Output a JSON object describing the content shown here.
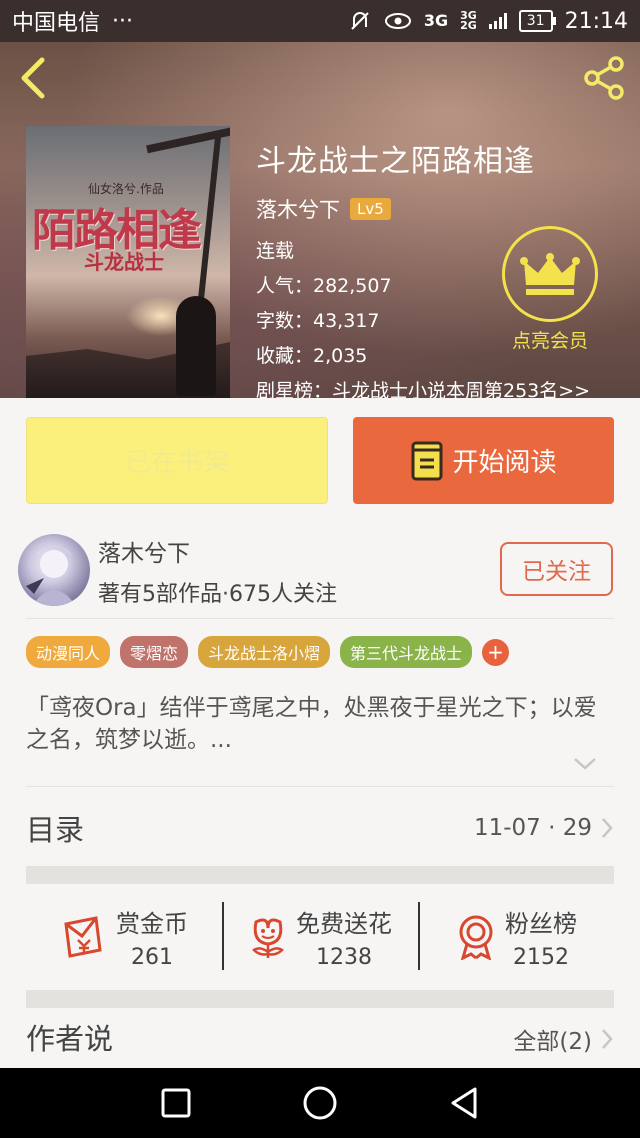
{
  "status_bar": {
    "carrier": "中国电信",
    "dots": "···",
    "network_3g": "3G",
    "network_3g_small": "3G",
    "network_2g_small": "2G",
    "battery": "31",
    "time": "21:14"
  },
  "book": {
    "title": "斗龙战士之陌路相逢",
    "author": "落木兮下",
    "level": "Lv5",
    "status": "连载",
    "popularity": "人气：282,507",
    "word_count": "字数：43,317",
    "favorites": "收藏：2,035",
    "rank": "剧星榜：斗龙战士小说本周第253名>>",
    "cover": {
      "author_line": "仙女洛兮.作品",
      "title": "陌路相逢",
      "subtitle": "斗龙战士"
    }
  },
  "vip": {
    "label": "点亮会员"
  },
  "buttons": {
    "shelf": "已在书架",
    "read": "开始阅读"
  },
  "author_info": {
    "name": "落木兮下",
    "meta": "著有5部作品·675人关注",
    "follow": "已关注"
  },
  "tags": [
    {
      "label": "动漫同人",
      "color": "#f0a93c"
    },
    {
      "label": "零熠恋",
      "color": "#c0736a"
    },
    {
      "label": "斗龙战士洛小熠",
      "color": "#d8a43c"
    },
    {
      "label": "第三代斗龙战士",
      "color": "#8ab34a"
    }
  ],
  "tag_add": "+",
  "intro": "「鸢夜Ora」结伴于鸢尾之中，处黑夜于星光之下；以爱之名，筑梦以逝。...",
  "catalog": {
    "title": "目录",
    "latest": "11-07 · 29"
  },
  "stats": [
    {
      "label": "赏金币",
      "value": "261",
      "icon": "red-envelope-yen-icon"
    },
    {
      "label": "免费送花",
      "value": "1238",
      "icon": "flower-icon"
    },
    {
      "label": "粉丝榜",
      "value": "2152",
      "icon": "award-ribbon-icon"
    }
  ],
  "author_says": {
    "title": "作者说",
    "all": "全部(2)"
  },
  "colors": {
    "accent_orange": "#e9683e",
    "shelf_yellow": "#fbf07c",
    "vip_yellow": "#f4e24c",
    "icon_red": "#d9472f"
  }
}
